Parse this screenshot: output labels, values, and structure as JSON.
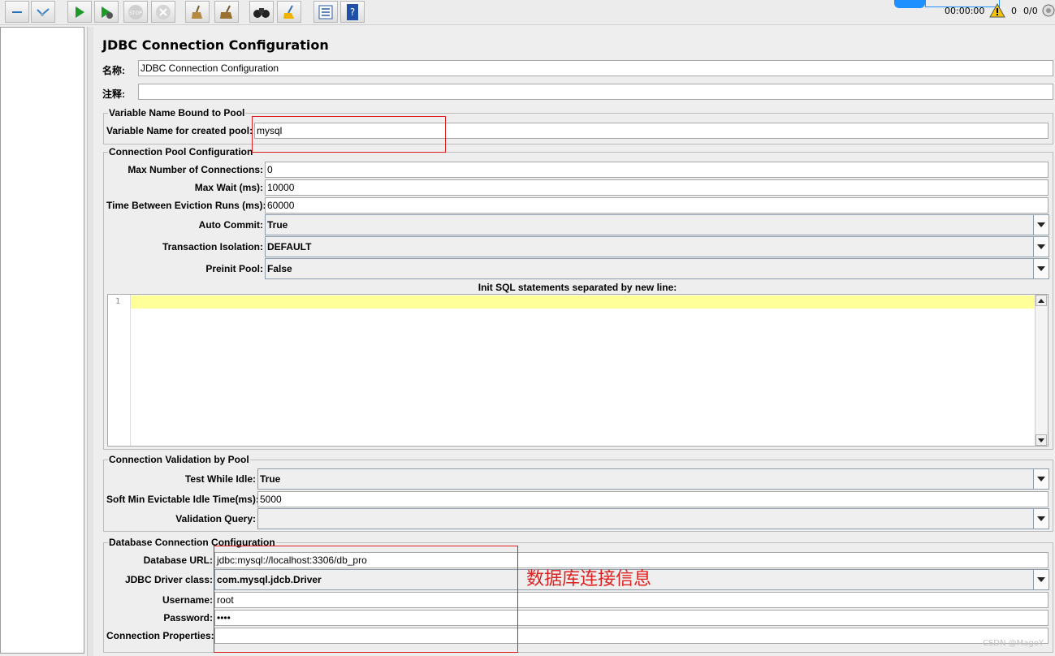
{
  "toolbar": {
    "buttons": [
      "collapse",
      "toggle",
      "start",
      "start-no-pause",
      "stop",
      "shutdown",
      "clear",
      "clear-all",
      "search",
      "reset-search",
      "function-helper",
      "help"
    ]
  },
  "status": {
    "elapsed": "00:00:00",
    "warnings": "0",
    "threads": "0/0"
  },
  "panel": {
    "title": "JDBC Connection Configuration",
    "name_label": "名称:",
    "name_value": "JDBC Connection Configuration",
    "comment_label": "注释:",
    "comment_value": ""
  },
  "variable_group": {
    "title": "Variable Name Bound to Pool",
    "var_label": "Variable Name for created pool:",
    "var_value": "mysql"
  },
  "pool_group": {
    "title": "Connection Pool Configuration",
    "max_conn_label": "Max Number of Connections:",
    "max_conn_value": "0",
    "max_wait_label": "Max Wait (ms):",
    "max_wait_value": "10000",
    "eviction_label": "Time Between Eviction Runs (ms):",
    "eviction_value": "60000",
    "auto_commit_label": "Auto Commit:",
    "auto_commit_value": "True",
    "isolation_label": "Transaction Isolation:",
    "isolation_value": "DEFAULT",
    "preinit_label": "Preinit Pool:",
    "preinit_value": "False",
    "init_sql_label": "Init SQL statements separated by new line:",
    "line_number": "1"
  },
  "validation_group": {
    "title": "Connection Validation by Pool",
    "test_idle_label": "Test While Idle:",
    "test_idle_value": "True",
    "soft_min_label": "Soft Min Evictable Idle Time(ms):",
    "soft_min_value": "5000",
    "query_label": "Validation Query:",
    "query_value": ""
  },
  "db_group": {
    "title": "Database Connection Configuration",
    "url_label": "Database URL:",
    "url_value": "jdbc:mysql://localhost:3306/db_pro",
    "driver_label": "JDBC Driver class:",
    "driver_value": "com.mysql.jdcb.Driver",
    "user_label": "Username:",
    "user_value": "root",
    "password_label": "Password:",
    "password_value": "••••",
    "props_label": "Connection Properties:",
    "props_value": ""
  },
  "annotation": {
    "note": "数据库连接信息",
    "color": "#e02020"
  },
  "watermark": "CSDN @MagoY"
}
